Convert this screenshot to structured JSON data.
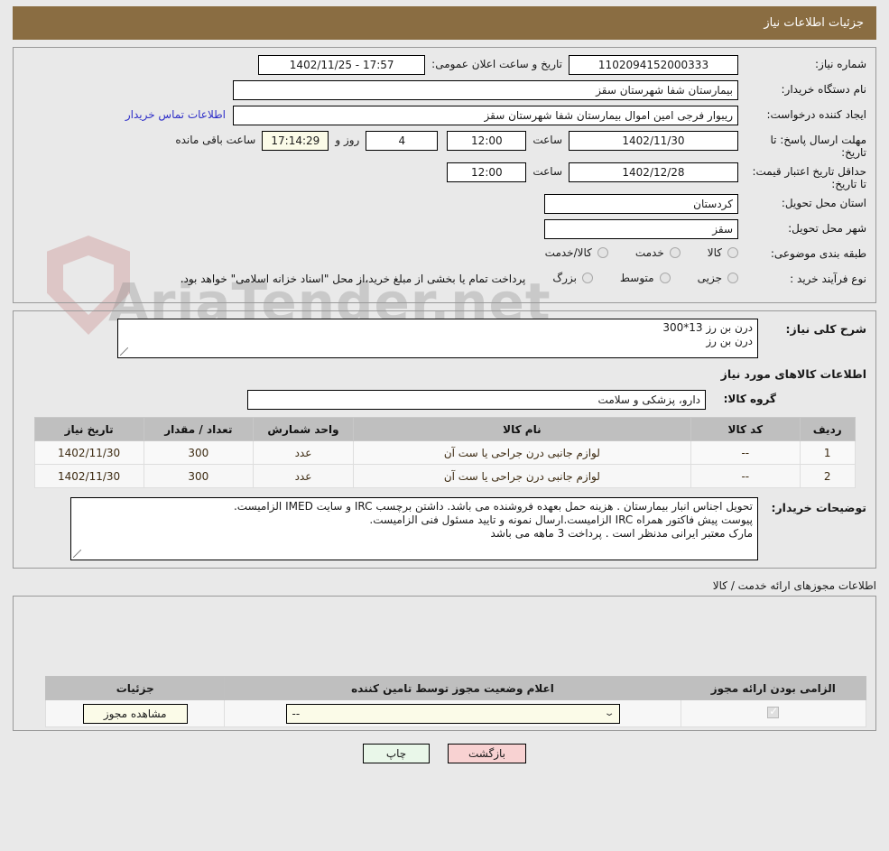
{
  "header": {
    "title": "جزئیات اطلاعات نیاز"
  },
  "info": {
    "need_number_label": "شماره نیاز:",
    "need_number_value": "1102094152000333",
    "announce_label": "تاریخ و ساعت اعلان عمومی:",
    "announce_value": "17:57 - 1402/11/25",
    "buyer_org_label": "نام دستگاه خریدار:",
    "buyer_org_value": "بیمارستان شفا شهرستان سقز",
    "requester_label": "ایجاد کننده درخواست:",
    "requester_value": "ریبوار فرجی امین اموال بیمارستان شفا شهرستان سقز",
    "contact_link": "اطلاعات تماس خریدار",
    "deadline_label": "مهلت ارسال پاسخ: تا تاریخ:",
    "deadline_date": "1402/11/30",
    "hour_label": "ساعت",
    "deadline_time": "12:00",
    "days_value": "4",
    "days_label": "روز و",
    "countdown_value": "17:14:29",
    "countdown_label": "ساعت باقی مانده",
    "validity_label": "حداقل تاریخ اعتبار قیمت: تا تاریخ:",
    "validity_date": "1402/12/28",
    "validity_time": "12:00",
    "province_label": "استان محل تحویل:",
    "province_value": "کردستان",
    "city_label": "شهر محل تحویل:",
    "city_value": "سقز",
    "category_label": "طبقه بندی موضوعی:",
    "category_options": [
      "کالا",
      "خدمت",
      "کالا/خدمت"
    ],
    "process_label": "نوع فرآیند خرید :",
    "process_options": [
      "جزیی",
      "متوسط",
      "بزرگ"
    ],
    "process_note": "پرداخت تمام یا بخشی از مبلغ خرید،از محل \"اسناد خزانه اسلامی\" خواهد بود."
  },
  "description": {
    "label": "شرح کلی نیاز:",
    "value": "درن بن رز 13*300\nدرن بن رز"
  },
  "goods": {
    "section_title": "اطلاعات کالاهای مورد نیاز",
    "group_label": "گروه کالا:",
    "group_value": "دارو، پزشکی و سلامت",
    "columns": [
      "ردیف",
      "کد کالا",
      "نام کالا",
      "واحد شمارش",
      "تعداد / مقدار",
      "تاریخ نیاز"
    ],
    "rows": [
      {
        "row": "1",
        "code": "--",
        "name": "لوازم جانبی درن جراحی یا ست آن",
        "unit": "عدد",
        "qty": "300",
        "date": "1402/11/30"
      },
      {
        "row": "2",
        "code": "--",
        "name": "لوازم جانبی درن جراحی یا ست آن",
        "unit": "عدد",
        "qty": "300",
        "date": "1402/11/30"
      }
    ]
  },
  "buyer_notes": {
    "label": "توضیحات خریدار:",
    "value": "تحویل اجناس  انبار بیمارستان . هزینه حمل بعهده فروشنده می باشد.  داشتن برچسب IRC  و سایت  IMED  الزامیست.\nپیوست پیش فاکتور همراه IRC  الزامیست.ارسال نمونه و تایید مسئول فنی الزامیست.\nمارک معتبر ایرانی مدنظر است . پرداخت 3 ماهه می باشد"
  },
  "licenses": {
    "section_title": "اطلاعات مجوزهای ارائه خدمت / کالا",
    "columns": [
      "الزامی بودن ارائه مجوز",
      "اعلام وضعیت مجوز توسط تامین کننده",
      "جزئیات"
    ],
    "rows": [
      {
        "required": true,
        "status": "--",
        "detail_button": "مشاهده مجوز"
      }
    ]
  },
  "footer": {
    "print_label": "چاپ",
    "back_label": "بازگشت"
  },
  "watermark": {
    "text": "AriaTender.net"
  },
  "colors": {
    "header_bg": "#8a6d42",
    "link": "#2e2ec8",
    "print_btn": "#e9f7e9",
    "back_btn": "#f8d2d2",
    "field_highlight": "#fbfbe8"
  }
}
